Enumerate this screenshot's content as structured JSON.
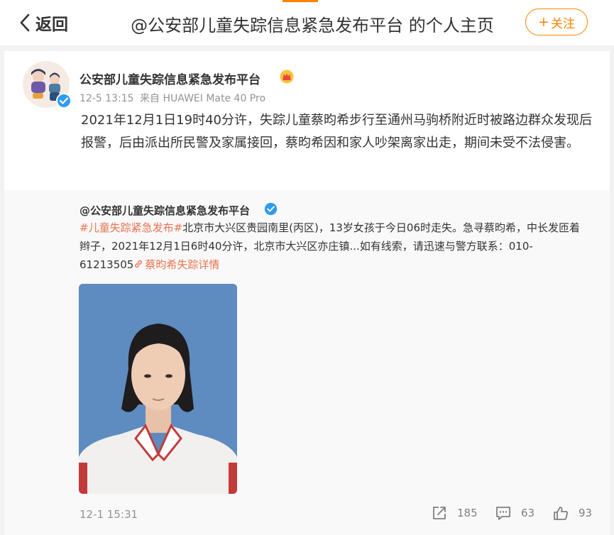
{
  "header": {
    "back_label": "返回",
    "title": "@公安部儿童失踪信息紧急发布平台 的个人主页",
    "follow_label": "关注",
    "accent_color": "#ff8200"
  },
  "post": {
    "author": "公安部儿童失踪信息紧急发布平台",
    "time": "12-5 13:15",
    "source": "来自 HUAWEI Mate 40 Pro",
    "text": "2021年12月1日19时40分许，失踪儿童蔡昀希步行至通州马驹桥附近时被路边群众发现后报警，后由派出所民警及家属接回，蔡昀希因和家人吵架离家出走，期间未受不法侵害。"
  },
  "repost": {
    "author": "@公安部儿童失踪信息紧急发布平台",
    "hashtag": "#儿童失踪紧急发布#",
    "text": "北京市大兴区贵园南里(丙区)，13岁女孩于今日06时走失。急寻蔡昀希，中长发匝着辫子，2021年12月1日6时40分许，北京市大兴区亦庄镇...如有线索，请迅速与警方联系：010-61213505",
    "link_text": "蔡昀希失踪详情",
    "time": "12-1 15:31",
    "shares": "185",
    "comments": "63",
    "likes": "93",
    "link_color": "#eb7350"
  },
  "icons": [
    "chevron-left-icon",
    "plus-icon",
    "verified-badge-icon",
    "crown-icon",
    "link-icon",
    "share-icon",
    "comment-icon",
    "like-icon"
  ]
}
